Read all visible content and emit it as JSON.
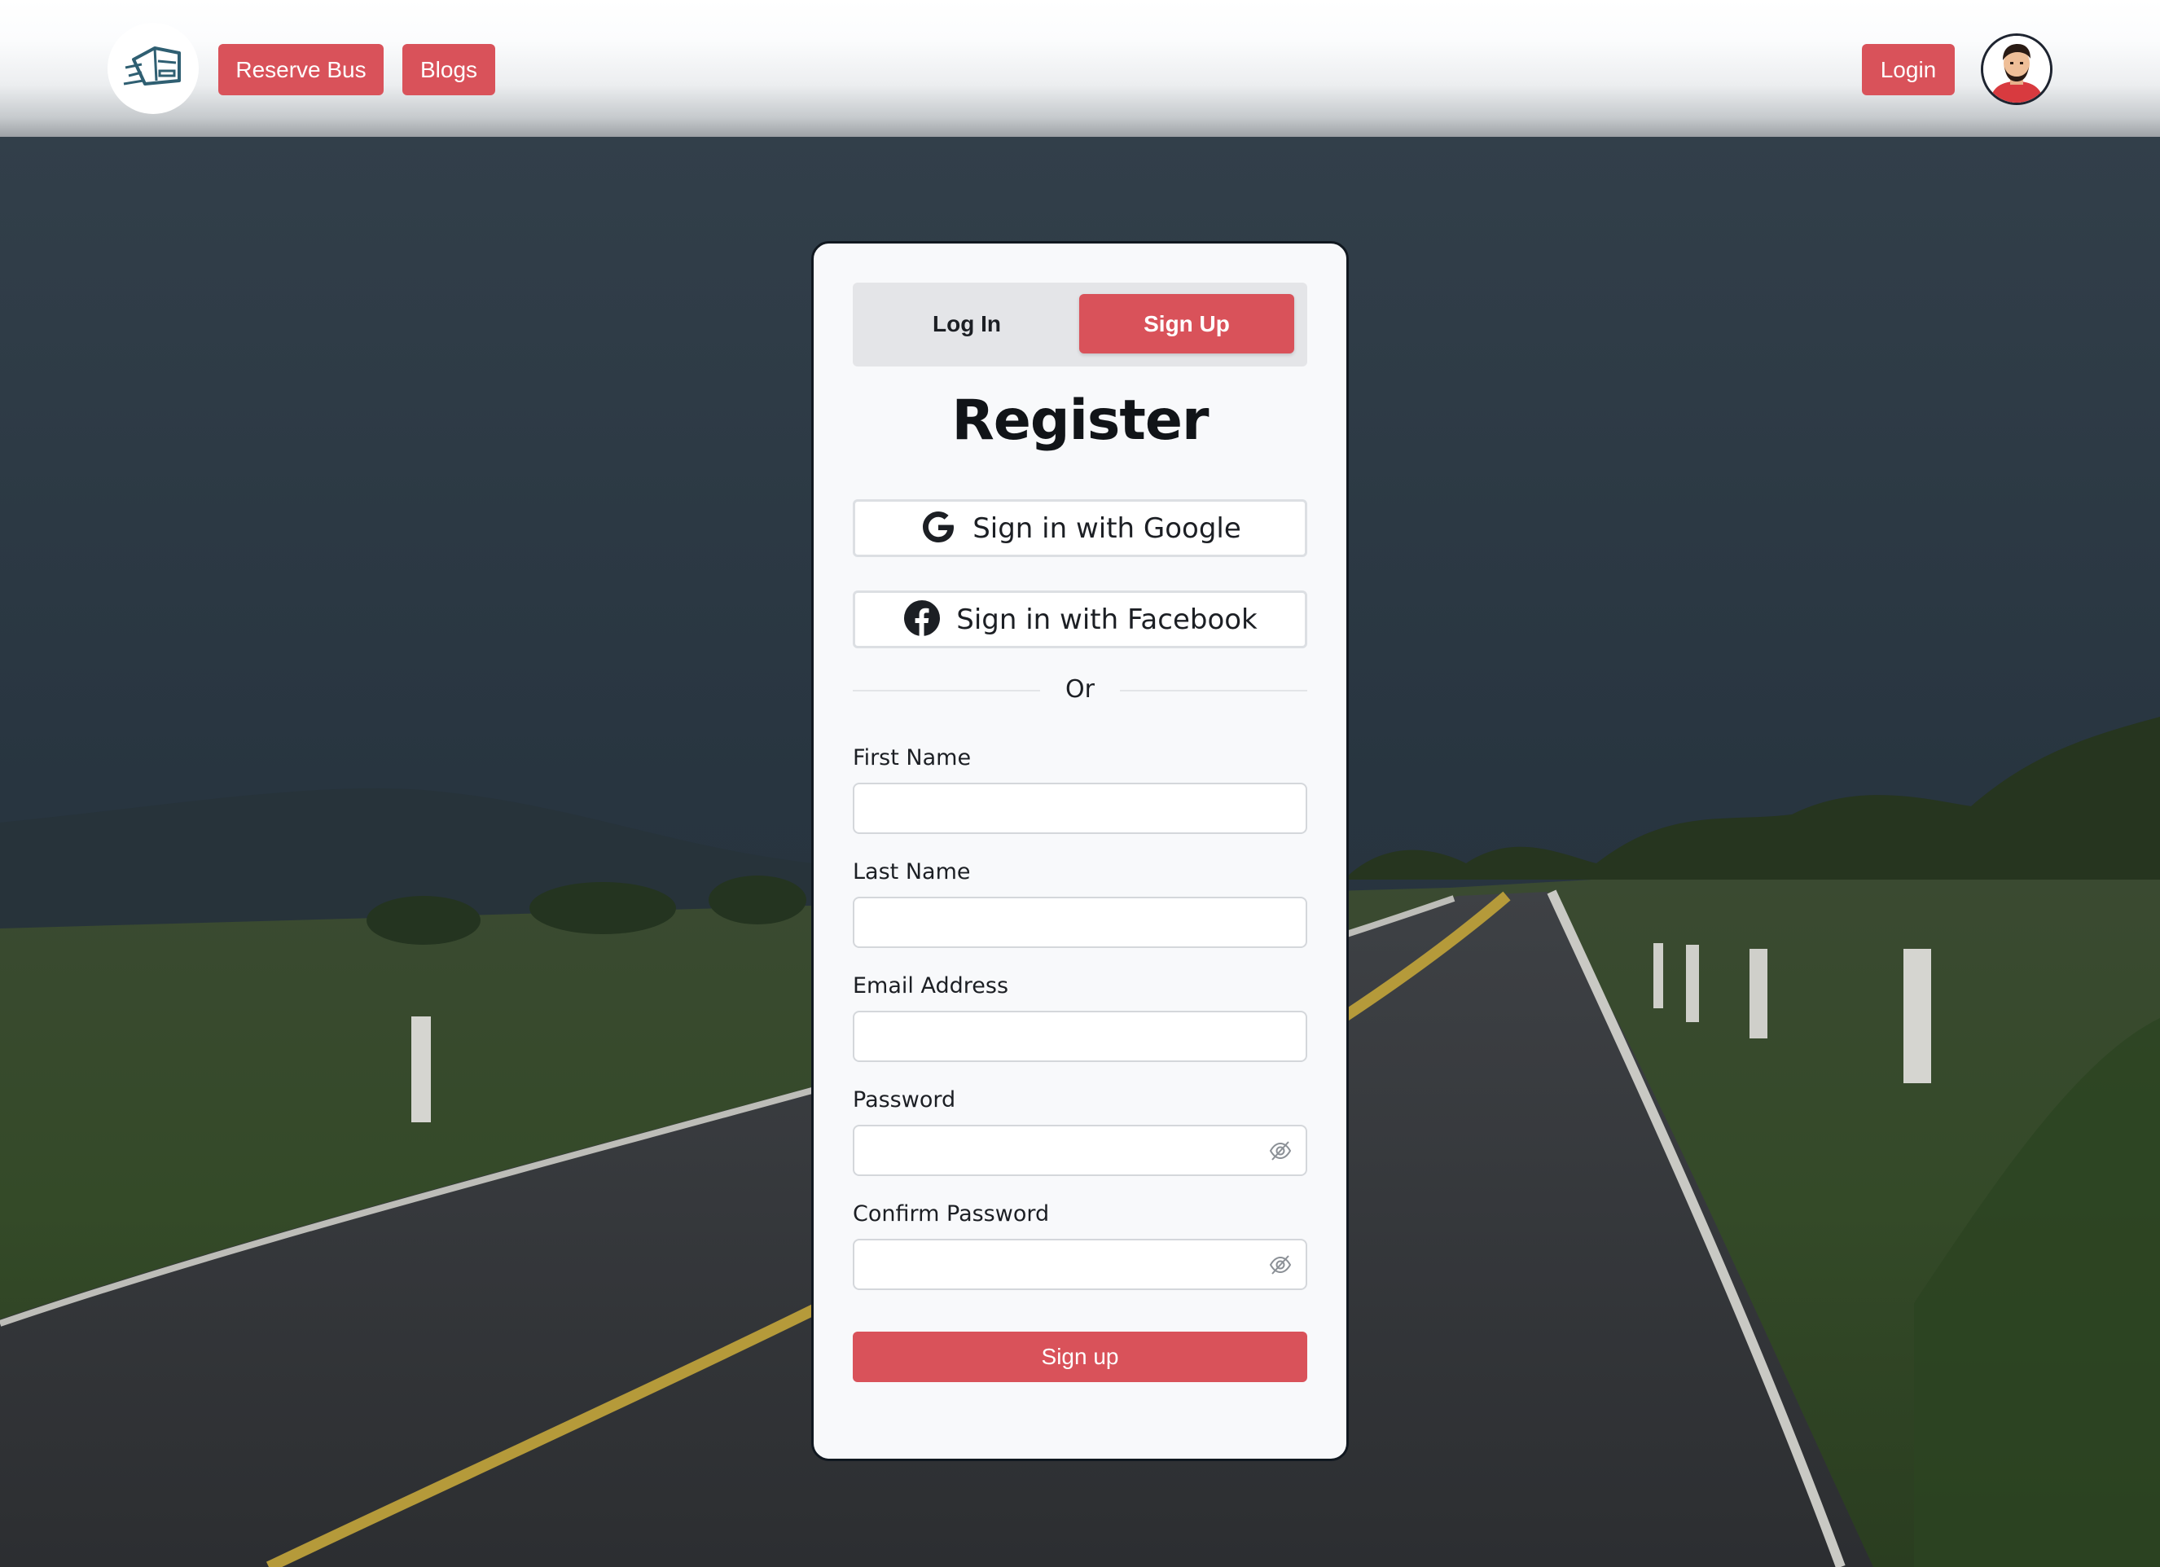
{
  "header": {
    "logo_icon": "bus-icon",
    "nav": [
      {
        "label": "Reserve Bus"
      },
      {
        "label": "Blogs"
      }
    ],
    "login_label": "Login",
    "avatar_icon": "user-avatar-icon"
  },
  "card": {
    "tabs": [
      {
        "label": "Log In",
        "active": false
      },
      {
        "label": "Sign Up",
        "active": true
      }
    ],
    "title": "Register",
    "social": {
      "google_label": "Sign in with Google",
      "google_icon": "google-icon",
      "facebook_label": "Sign in with Facebook",
      "facebook_icon": "facebook-icon"
    },
    "divider_text": "Or",
    "fields": {
      "first_name": {
        "label": "First Name",
        "value": ""
      },
      "last_name": {
        "label": "Last Name",
        "value": ""
      },
      "email": {
        "label": "Email Address",
        "value": ""
      },
      "password": {
        "label": "Password",
        "value": "",
        "toggle_icon": "eye-slash-icon"
      },
      "confirm_password": {
        "label": "Confirm Password",
        "value": "",
        "toggle_icon": "eye-slash-icon"
      }
    },
    "submit_label": "Sign up"
  },
  "colors": {
    "accent": "#d9525a",
    "card_bg": "#f8f9fb",
    "text": "#1c1f24"
  }
}
